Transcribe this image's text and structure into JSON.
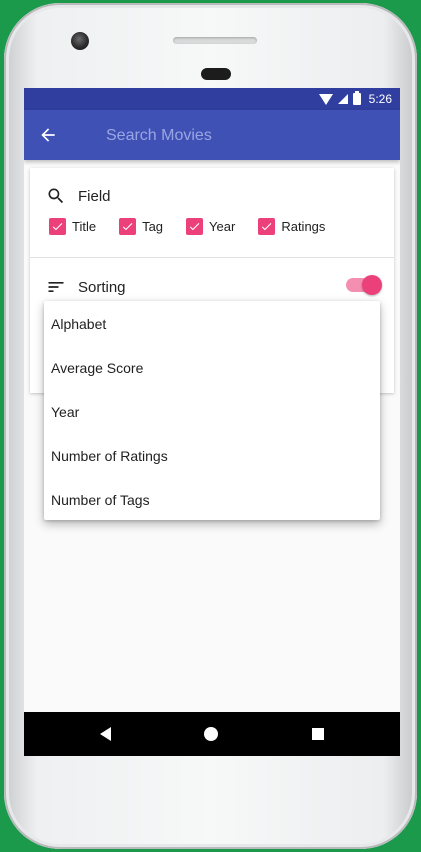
{
  "status_bar": {
    "time": "5:26"
  },
  "app_bar": {
    "search_placeholder": "Search Movies"
  },
  "filter_card": {
    "field_label": "Field",
    "checkboxes": [
      {
        "label": "Title",
        "checked": true
      },
      {
        "label": "Tag",
        "checked": true
      },
      {
        "label": "Year",
        "checked": true
      },
      {
        "label": "Ratings",
        "checked": true
      }
    ],
    "sorting_label": "Sorting",
    "sorting_enabled": true
  },
  "sort_menu": {
    "items": [
      "Alphabet",
      "Average Score",
      "Year",
      "Number of Ratings",
      "Number of Tags"
    ]
  },
  "colors": {
    "status_bar": "#303f9f",
    "app_bar": "#3f51b5",
    "accent": "#ec407a",
    "frame_background": "#1b9a4b"
  },
  "icons": [
    "back-arrow-icon",
    "search-icon",
    "sort-icon",
    "check-icon",
    "wifi-icon",
    "signal-icon",
    "battery-icon",
    "nav-back-icon",
    "nav-home-icon",
    "nav-recent-icon"
  ]
}
